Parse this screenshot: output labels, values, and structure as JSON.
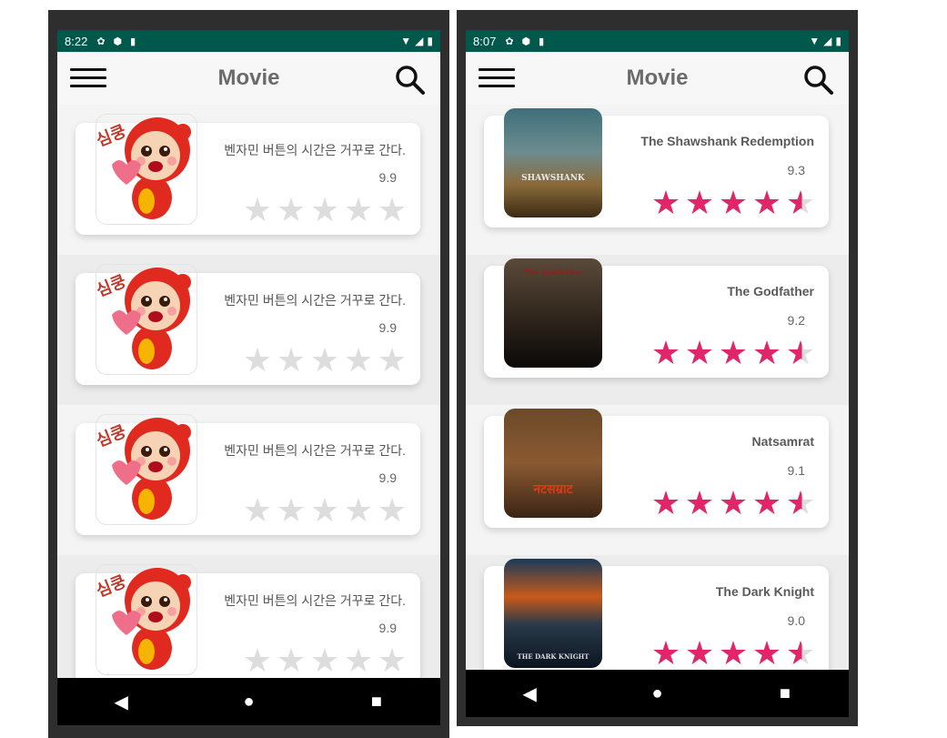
{
  "left_phone": {
    "status": {
      "time": "8:22"
    },
    "app_title": "Movie",
    "items": [
      {
        "title": "벤자민 버튼의 시간은 거꾸로 간다.",
        "rating": "9.9",
        "stars_filled": 0,
        "sticker_text": "심쿵"
      },
      {
        "title": "벤자민 버튼의 시간은 거꾸로 간다.",
        "rating": "9.9",
        "stars_filled": 0,
        "sticker_text": "심쿵"
      },
      {
        "title": "벤자민 버튼의 시간은 거꾸로 간다.",
        "rating": "9.9",
        "stars_filled": 0,
        "sticker_text": "심쿵"
      },
      {
        "title": "벤자민 버튼의 시간은 거꾸로 간다.",
        "rating": "9.9",
        "stars_filled": 0,
        "sticker_text": "심쿵"
      }
    ]
  },
  "right_phone": {
    "status": {
      "time": "8:07"
    },
    "app_title": "Movie",
    "items": [
      {
        "title": "The Shawshank Redemption",
        "rating": "9.3",
        "stars_filled": 4.5,
        "poster_text": "SHAWSHANK"
      },
      {
        "title": "The Godfather",
        "rating": "9.2",
        "stars_filled": 4.5,
        "poster_text": "The Godfather"
      },
      {
        "title": "Natsamrat",
        "rating": "9.1",
        "stars_filled": 4.5,
        "poster_text": "नटसम्राट"
      },
      {
        "title": "The Dark Knight",
        "rating": "9.0",
        "stars_filled": 4.5,
        "poster_text": "THE DARK KNIGHT"
      }
    ]
  },
  "nav": {
    "back": "◀",
    "home": "●",
    "recents": "■"
  },
  "colors": {
    "status_bar": "#00574b",
    "star_filled": "#e0256a",
    "star_empty": "#dddddd"
  }
}
